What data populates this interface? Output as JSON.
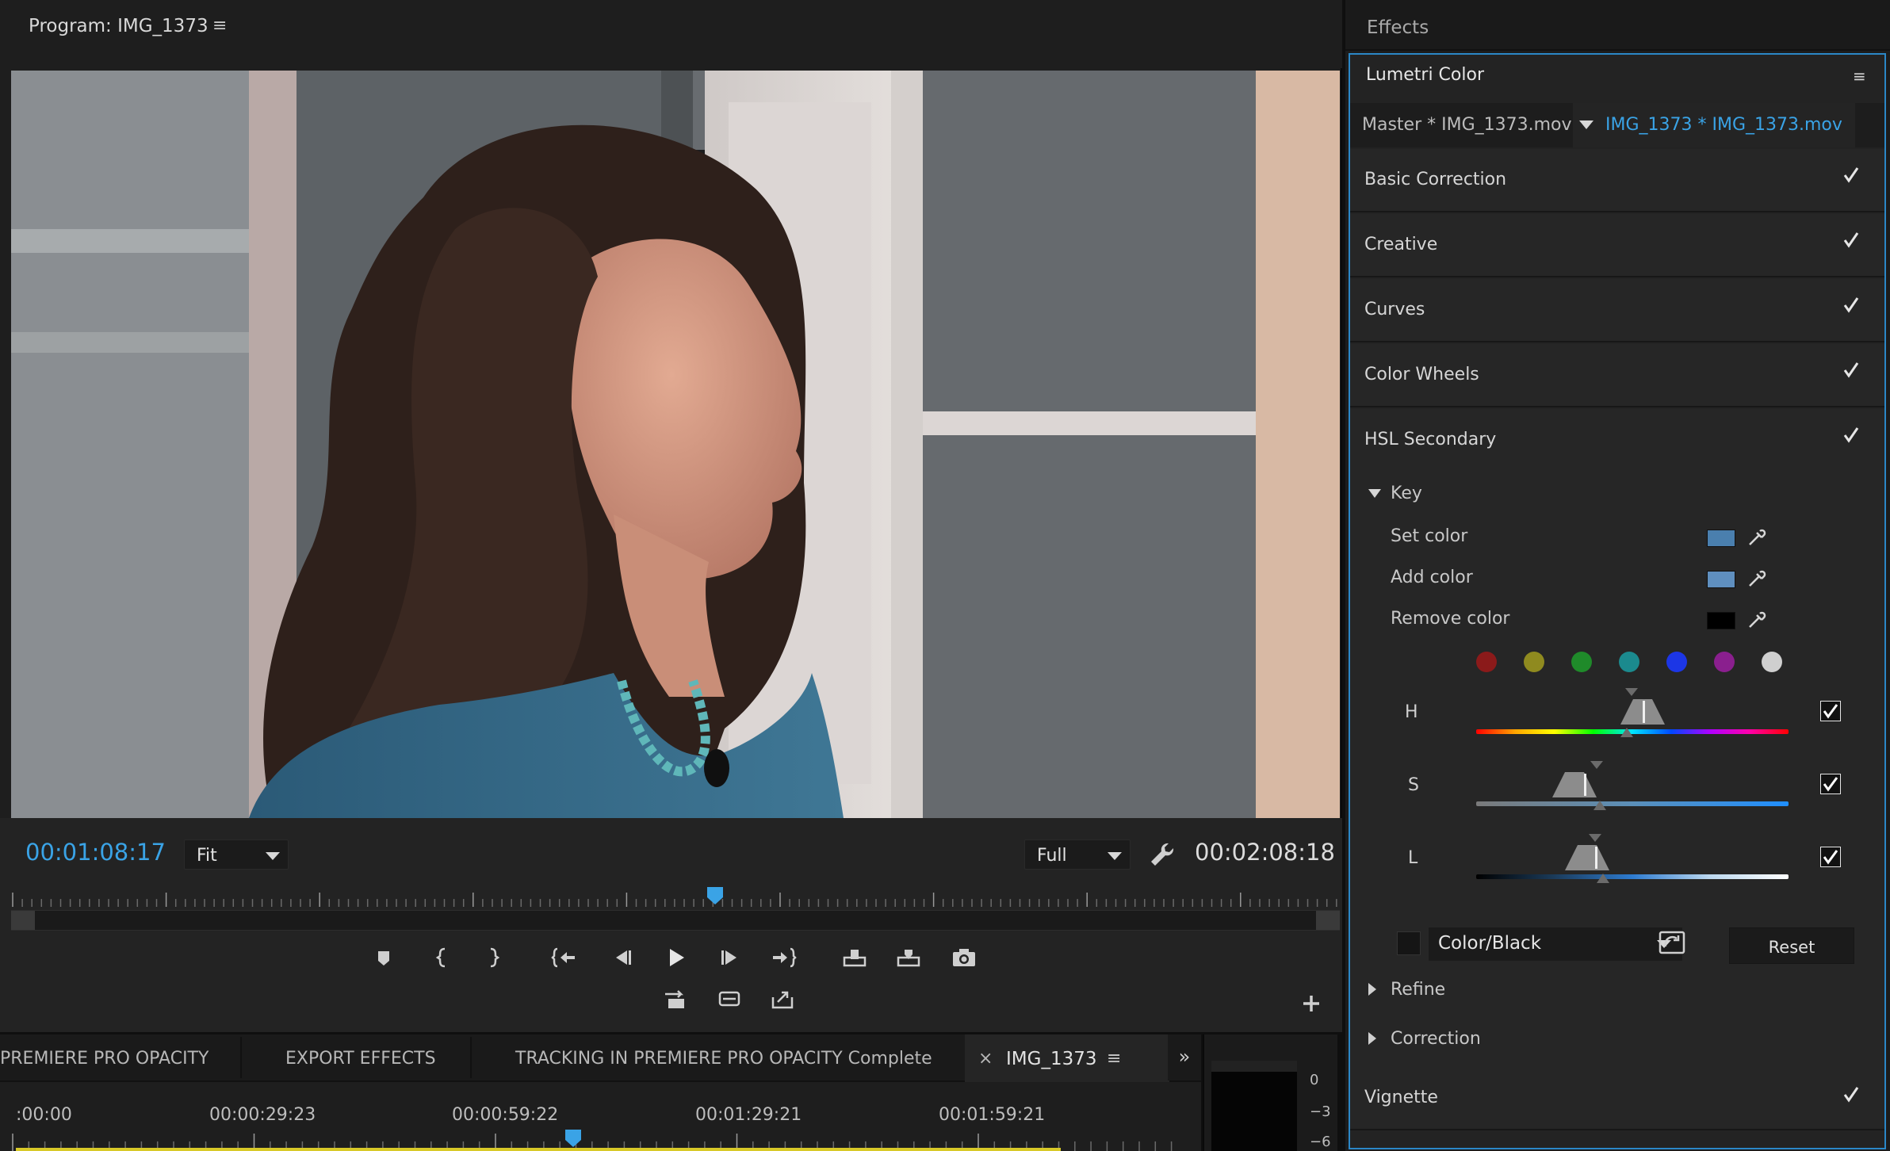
{
  "monitor": {
    "title": "Program: IMG_1373",
    "menu_glyph": "≡",
    "current_timecode": "00:01:08:17",
    "fit": "Fit",
    "resolution": "Full",
    "duration_timecode": "00:02:08:18",
    "playhead_position": 0.526
  },
  "timeline": {
    "tabs": [
      "PREMIERE PRO OPACITY",
      "EXPORT EFFECTS",
      "TRACKING IN PREMIERE PRO OPACITY Complete"
    ],
    "active_tab": "IMG_1373",
    "close_glyph": "×",
    "menu_glyph": "≡",
    "more_glyph": "»",
    "times": [
      ":00:00",
      "00:00:29:23",
      "00:00:59:22",
      "00:01:29:21",
      "00:01:59:21"
    ],
    "meter_labels": [
      "0",
      "−3",
      "−6"
    ],
    "playhead_position": 0.47
  },
  "effects": {
    "title": "Effects",
    "lumetri": {
      "title": "Lumetri Color",
      "menu_glyph": "≡",
      "master_tab": "Master * IMG_1373.mov",
      "clip_tab": "IMG_1373 * IMG_1373.mov",
      "sections": [
        {
          "label": "Basic Correction",
          "enabled": true
        },
        {
          "label": "Creative",
          "enabled": true
        },
        {
          "label": "Curves",
          "enabled": true
        },
        {
          "label": "Color Wheels",
          "enabled": true
        },
        {
          "label": "HSL Secondary",
          "enabled": true
        }
      ],
      "key": {
        "label": "Key",
        "set_color": "Set color",
        "add_color": "Add color",
        "remove_color": "Remove color",
        "set_swatch": "#4a7fae",
        "add_swatch": "#5f8fbf",
        "remove_swatch": "#000000",
        "presets": [
          "#8b1a1a",
          "#8f8a1f",
          "#1f8a2a",
          "#1b8a8e",
          "#1c36e6",
          "#8a1f8e",
          "#cfcfcf"
        ],
        "h_label": "H",
        "s_label": "S",
        "l_label": "L",
        "display": "Color/Black",
        "reset": "Reset"
      },
      "refine": "Refine",
      "correction": "Correction",
      "vignette": "Vignette"
    }
  }
}
